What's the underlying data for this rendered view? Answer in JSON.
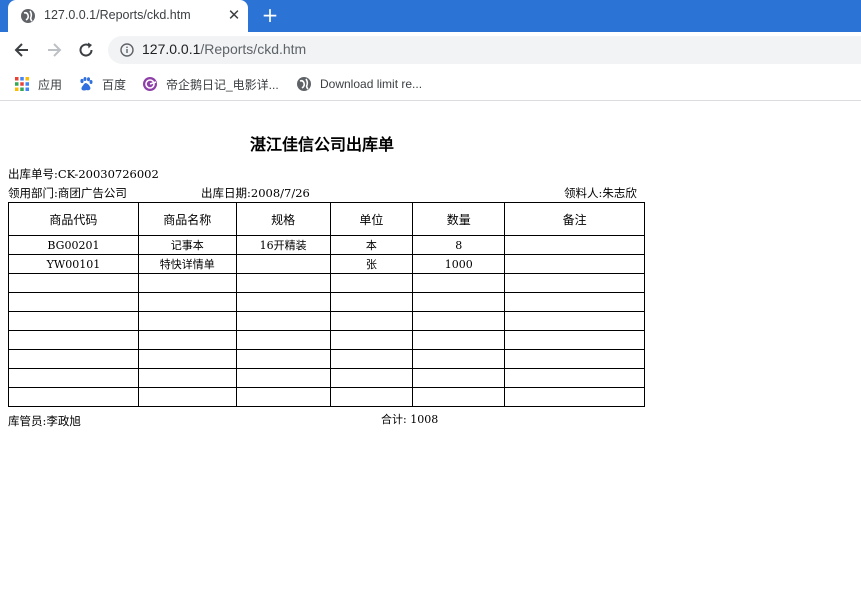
{
  "browser": {
    "tab_title": "127.0.0.1/Reports/ckd.htm",
    "new_tab": "+",
    "close": "✕",
    "url_host": "127.0.0.1",
    "url_path": "/Reports/ckd.htm",
    "bookmarks": [
      {
        "label": "应用",
        "icon": "apps-grid-icon"
      },
      {
        "label": "百度",
        "icon": "baidu-paw-icon"
      },
      {
        "label": "帝企鹅日记_电影详...",
        "icon": "bookmark-site-icon"
      },
      {
        "label": "Download limit re...",
        "icon": "globe-icon"
      }
    ]
  },
  "report": {
    "title": "湛江佳信公司出库单",
    "order_no": "出库单号:CK-20030726002",
    "department": "领用部门:商团广告公司",
    "date": "出库日期:2008/7/26",
    "receiver": "领料人:朱志欣",
    "columns": [
      "商品代码",
      "商品名称",
      "规格",
      "单位",
      "数量",
      "备注"
    ],
    "rows": [
      [
        "BG00201",
        "记事本",
        "16开精装",
        "本",
        "8",
        ""
      ],
      [
        "YW00101",
        "特快详情单",
        "",
        "张",
        "1000",
        ""
      ],
      [
        "",
        "",
        "",
        "",
        "",
        ""
      ],
      [
        "",
        "",
        "",
        "",
        "",
        ""
      ],
      [
        "",
        "",
        "",
        "",
        "",
        ""
      ],
      [
        "",
        "",
        "",
        "",
        "",
        ""
      ],
      [
        "",
        "",
        "",
        "",
        "",
        ""
      ],
      [
        "",
        "",
        "",
        "",
        "",
        ""
      ],
      [
        "",
        "",
        "",
        "",
        "",
        ""
      ]
    ],
    "keeper": "库管员:李政旭",
    "total": "合计: 1008"
  }
}
